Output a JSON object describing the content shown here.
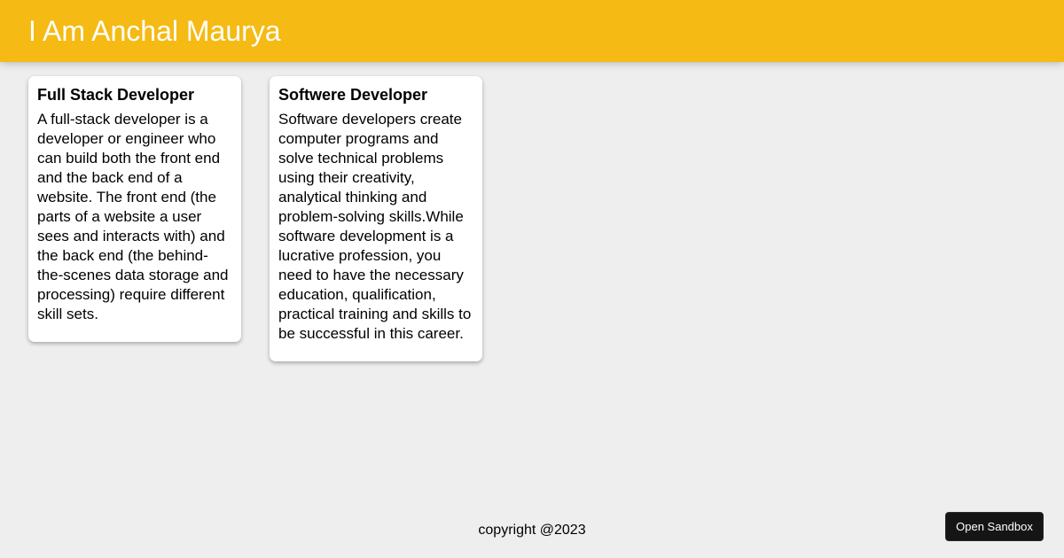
{
  "header": {
    "title": "I Am Anchal Maurya"
  },
  "cards": [
    {
      "title": "Full Stack Developer",
      "body": "A full-stack developer is a developer or engineer who can build both the front end and the back end of a website. The front end (the parts of a website a user sees and interacts with) and the back end (the behind-the-scenes data storage and processing) require different skill sets."
    },
    {
      "title": "Softwere Developer",
      "body": "Software developers create computer programs and solve technical problems using their creativity, analytical thinking and problem-solving skills.While software development is a lucrative profession, you need to have the necessary education, qualification, practical training and skills to be successful in this career."
    }
  ],
  "footer": {
    "text": "copyright @2023"
  },
  "sandbox": {
    "label": "Open Sandbox"
  },
  "colors": {
    "header_bg": "#f5ba13",
    "page_bg": "#eeeeee",
    "button_bg": "#151515"
  }
}
